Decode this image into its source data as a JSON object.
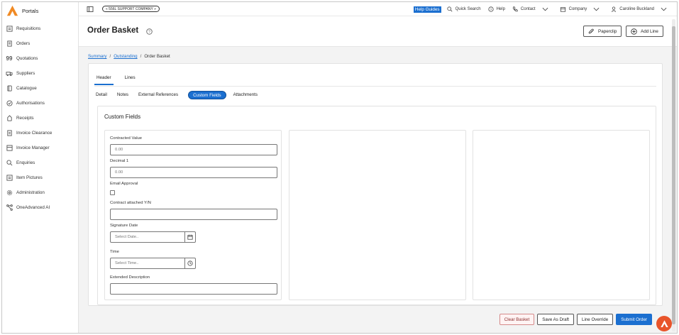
{
  "app": {
    "name": "Portals"
  },
  "colors": {
    "accent": "#1b6fd0",
    "brand_orange": "#f08a24",
    "fab": "#e8542a"
  },
  "sidebar": {
    "items": [
      {
        "label": "Requisitions",
        "icon": "requisitions-icon"
      },
      {
        "label": "Orders",
        "icon": "orders-icon"
      },
      {
        "label": "Quotations",
        "icon": "quotations-icon"
      },
      {
        "label": "Suppliers",
        "icon": "suppliers-icon"
      },
      {
        "label": "Catalogue",
        "icon": "catalogue-icon"
      },
      {
        "label": "Authorisations",
        "icon": "authorisations-icon"
      },
      {
        "label": "Receipts",
        "icon": "receipts-icon"
      },
      {
        "label": "Invoice Clearance",
        "icon": "invoice-clearance-icon"
      },
      {
        "label": "Invoice Manager",
        "icon": "invoice-manager-icon"
      },
      {
        "label": "Enquiries",
        "icon": "search-icon"
      },
      {
        "label": "Item Pictures",
        "icon": "item-pictures-icon"
      },
      {
        "label": "Administration",
        "icon": "gear-icon"
      },
      {
        "label": "OneAdvanced AI",
        "icon": "ai-icon"
      }
    ]
  },
  "topbar": {
    "company_pill": "« 556L SUPPORT COMPANY »",
    "help_guides": "Help Guides",
    "quick_search": "Quick Search",
    "help": "Help",
    "contact": "Contact",
    "company": "Company",
    "user": "Caroline Buckland"
  },
  "header": {
    "title": "Order Basket",
    "paperclip_label": "Paperclip",
    "add_line_label": "Add Line"
  },
  "breadcrumb": {
    "items": [
      "Summary",
      "Outstanding"
    ],
    "current": "Order Basket"
  },
  "tabs": {
    "primary": [
      "Header",
      "Lines"
    ],
    "secondary": [
      "Detail",
      "Notes",
      "External References",
      "Custom Fields",
      "Attachments"
    ]
  },
  "custom_fields": {
    "title": "Custom Fields",
    "contracted_value": {
      "label": "Contracted Value",
      "value": "0.00"
    },
    "decimal_1": {
      "label": "Decimal 1",
      "value": "0.00"
    },
    "email_approval": {
      "label": "Email Approval"
    },
    "contract_attached": {
      "label": "Contract attached Y/N",
      "value": ""
    },
    "signature_date": {
      "label": "Signature Date",
      "placeholder": "Select Date.."
    },
    "time": {
      "label": "Time",
      "placeholder": "Select Time.."
    },
    "extended_description": {
      "label": "Extended Description",
      "value": ""
    }
  },
  "footer": {
    "clear_basket": "Clear Basket",
    "save_as_draft": "Save As Draft",
    "line_override": "Line Override",
    "submit_order": "Submit Order"
  }
}
